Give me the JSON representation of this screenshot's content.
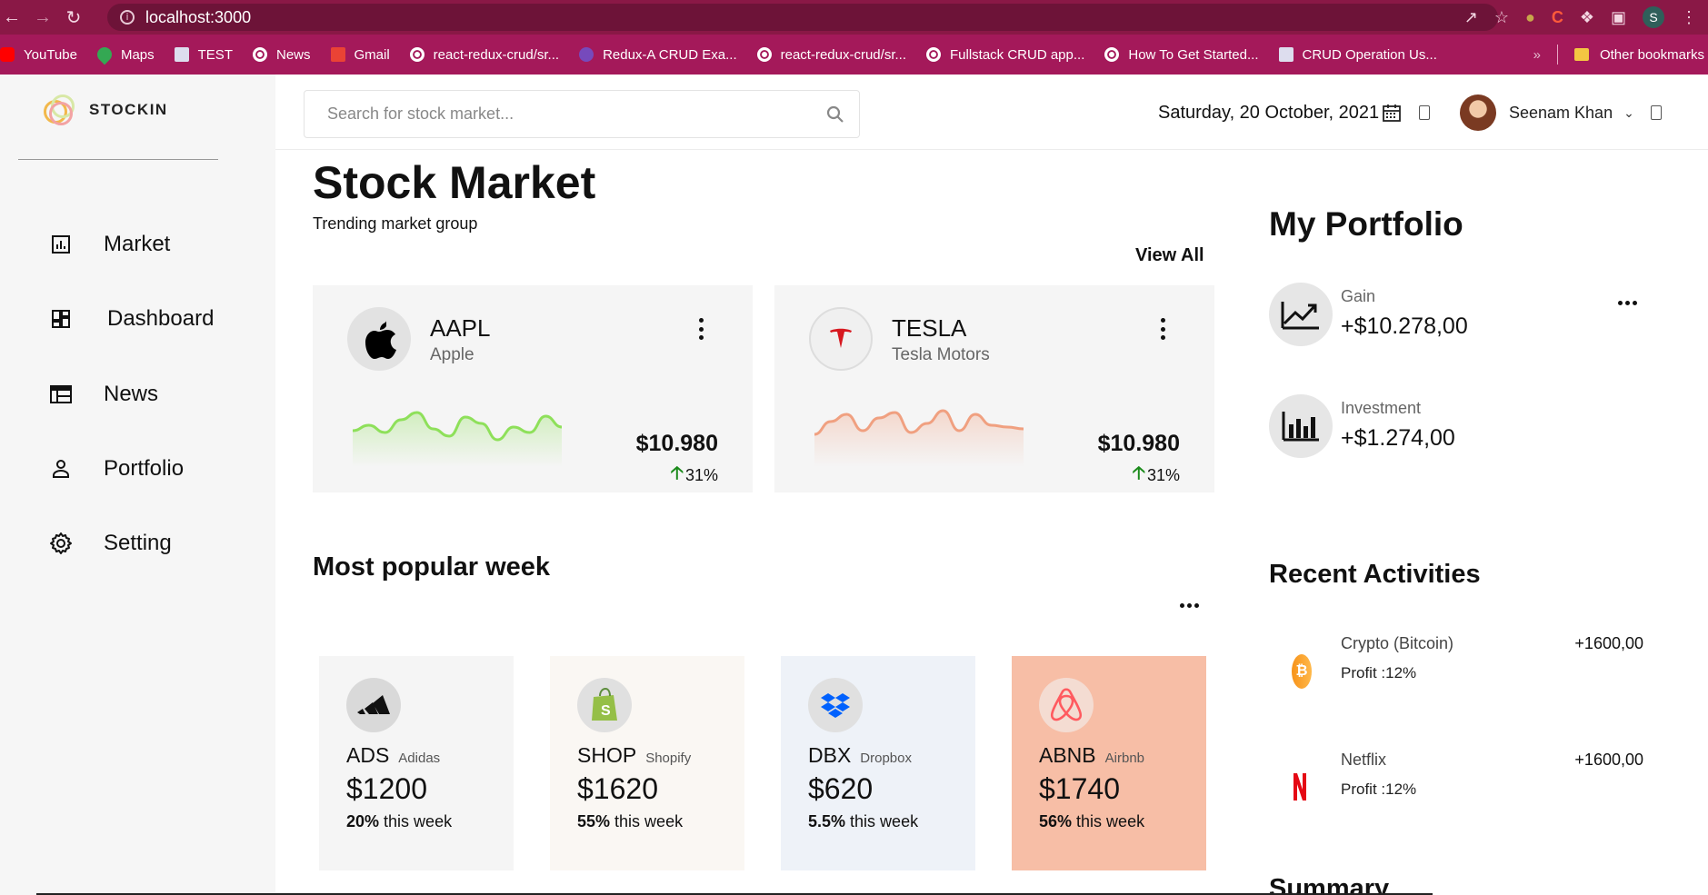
{
  "browser": {
    "url": "localhost:3000",
    "bookmarks": [
      {
        "label": "YouTube",
        "icon": "youtube-icon"
      },
      {
        "label": "Maps",
        "icon": "maps-icon"
      },
      {
        "label": "TEST",
        "icon": "bxm-icon"
      },
      {
        "label": "News",
        "icon": "globe-icon"
      },
      {
        "label": "Gmail",
        "icon": "gmail-icon"
      },
      {
        "label": "react-redux-crud/sr...",
        "icon": "globe-icon"
      },
      {
        "label": "Redux-A CRUD Exa...",
        "icon": "redux-icon"
      },
      {
        "label": "react-redux-crud/sr...",
        "icon": "globe-icon"
      },
      {
        "label": "Fullstack CRUD app...",
        "icon": "globe-icon"
      },
      {
        "label": "How To Get Started...",
        "icon": "globe-icon"
      },
      {
        "label": "CRUD Operation Us...",
        "icon": "page-icon"
      }
    ],
    "other_bookmarks": "Other bookmarks",
    "profile_initial": "S"
  },
  "sidebar": {
    "logo_text": "STOCKIN",
    "items": [
      {
        "label": "Market",
        "icon": "market-icon"
      },
      {
        "label": "Dashboard",
        "icon": "dashboard-icon"
      },
      {
        "label": "News",
        "icon": "news-icon"
      },
      {
        "label": "Portfolio",
        "icon": "person-icon"
      },
      {
        "label": "Setting",
        "icon": "gear-icon"
      }
    ]
  },
  "header": {
    "search_placeholder": "Search for stock market...",
    "date": "Saturday, 20 October, 2021",
    "user_name": "Seenam Khan"
  },
  "market": {
    "title": "Stock Market",
    "subtitle": "Trending market group",
    "view_all": "View All",
    "cards": [
      {
        "ticker": "AAPL",
        "name": "Apple",
        "price": "$10.980",
        "change": "31%",
        "spark_color": "#8ee05a",
        "spark": [
          40,
          46,
          38,
          52,
          60,
          42,
          34,
          55,
          48,
          30,
          44,
          38,
          56,
          44
        ]
      },
      {
        "ticker": "TESLA",
        "name": "Tesla Motors",
        "price": "$10.980",
        "change": "31%",
        "spark_color": "#f0a080",
        "spark": [
          36,
          50,
          58,
          40,
          54,
          60,
          38,
          48,
          62,
          40,
          58,
          46,
          44,
          42
        ]
      }
    ]
  },
  "popular": {
    "title": "Most popular week",
    "cards": [
      {
        "ticker": "ADS",
        "name": "Adidas",
        "price": "$1200",
        "percent": "20%",
        "week_text": "this week",
        "bg": "#f5f5f5",
        "logo_bg": "#d9d9d9",
        "icon": "adidas-icon"
      },
      {
        "ticker": "SHOP",
        "name": "Shopify",
        "price": "$1620",
        "percent": "55%",
        "week_text": "this week",
        "bg": "#faf7f3",
        "logo_bg": "#e0e0e0",
        "icon": "shopify-icon"
      },
      {
        "ticker": "DBX",
        "name": "Dropbox",
        "price": "$620",
        "percent": "5.5%",
        "week_text": "this week",
        "bg": "#eef2f8",
        "logo_bg": "#e0e0e0",
        "icon": "dropbox-icon"
      },
      {
        "ticker": "ABNB",
        "name": "Airbnb",
        "price": "$1740",
        "percent": "56%",
        "week_text": "this week",
        "bg": "#f7bea6",
        "logo_bg": "#f4dcd2",
        "icon": "airbnb-icon"
      }
    ]
  },
  "portfolio": {
    "title": "My Portfolio",
    "gain_label": "Gain",
    "gain_value": "+$10.278,00",
    "investment_label": "Investment",
    "investment_value": "+$1.274,00"
  },
  "activities": {
    "title": "Recent Activities",
    "items": [
      {
        "name": "Crypto (Bitcoin)",
        "profit": "Profit :12%",
        "amount": "+1600,00",
        "icon": "bitcoin-icon"
      },
      {
        "name": "Netflix",
        "profit": "Profit :12%",
        "amount": "+1600,00",
        "icon": "netflix-icon"
      }
    ]
  },
  "summary_title": "Summary"
}
